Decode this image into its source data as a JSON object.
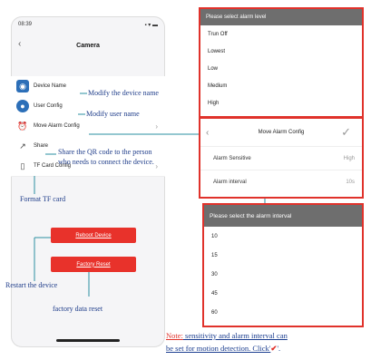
{
  "phone": {
    "time": "08:39",
    "status_icons": "▪ ▾ ▬",
    "title": "Camera",
    "rows": [
      {
        "label": "Device Name"
      },
      {
        "label": "User Config"
      },
      {
        "label": "Move Alarm Config"
      },
      {
        "label": "Share"
      },
      {
        "label": "TF Card Config"
      }
    ],
    "reboot": "Reboot Device",
    "factory": "Factory Reset"
  },
  "annotations": {
    "modify_device": "Modify the device name",
    "modify_user": "Modify user name",
    "share_line1": "Share the QR code to the person",
    "share_line2": "who needs to connect the device.",
    "format_tf": "Format TF card",
    "restart": "Restart the device",
    "factory_reset": "factory data reset"
  },
  "alarm_level": {
    "header": "Please select alarm level",
    "options": [
      "Trun Off",
      "Lowest",
      "Low",
      "Medium",
      "High"
    ]
  },
  "alarm_config": {
    "title": "Move Alarm Config",
    "sensitive_label": "Alarm Sensitive",
    "sensitive_value": "High",
    "interval_label": "Alarm interval",
    "interval_value": "10s"
  },
  "alarm_interval": {
    "header": "Please select the alarm interval",
    "options": [
      "10",
      "15",
      "30",
      "45",
      "60"
    ]
  },
  "note": {
    "prefix": "Note:",
    "line1": " sensitivity and alarm interval can",
    "line2": "be set for motion detection. Click'",
    "check": "✔",
    "end": "'."
  },
  "colors": {
    "accent_red": "#e0322b",
    "annotation_blue": "#1f3d8a",
    "teal": "#2a8fa0"
  }
}
